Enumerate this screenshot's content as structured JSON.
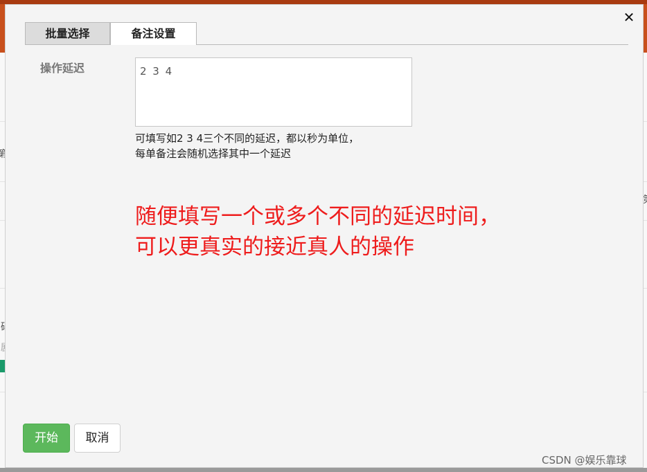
{
  "dialog": {
    "close_glyph": "✕",
    "tabs": [
      {
        "label": "批量选择"
      },
      {
        "label": "备注设置"
      }
    ],
    "delay": {
      "label": "操作延迟",
      "value": "2 3 4",
      "hint_line1": "可填写如2 3 4三个不同的延迟，都以秒为单位，",
      "hint_line2": "每单备注会随机选择其中一个延迟"
    },
    "annotation": {
      "line1": "随便填写一个或多个不同的延迟时间，",
      "line2": "可以更真实的接近真人的操作"
    },
    "buttons": {
      "start": "开始",
      "cancel": "取消"
    }
  },
  "background": {
    "glyphs": [
      "第",
      "码",
      "剧",
      "第"
    ]
  },
  "watermark": "CSDN @娱乐靠球",
  "colors": {
    "topbar": "#c8501c",
    "start_button": "#5cb85c",
    "annotation": "#ee1c1c"
  }
}
